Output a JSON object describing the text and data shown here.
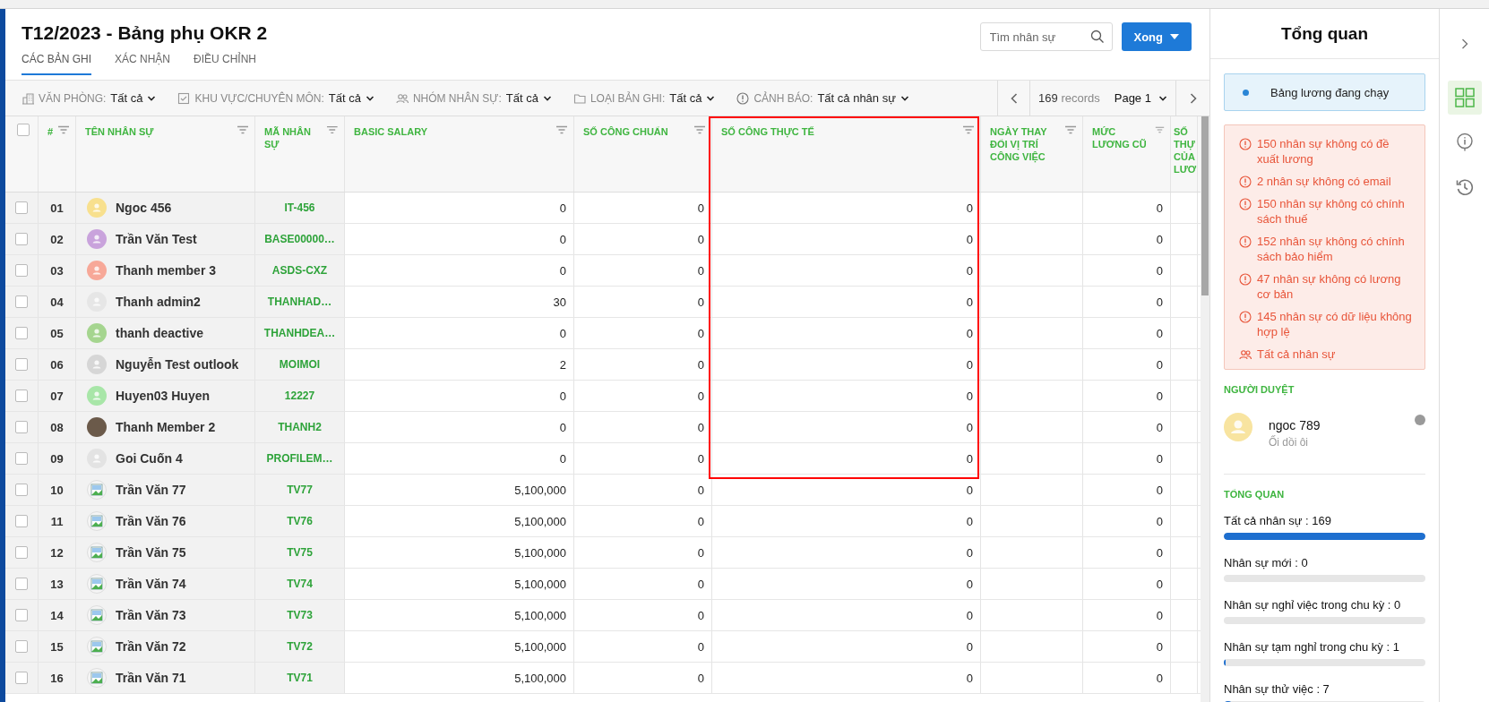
{
  "header": {
    "title": "T12/2023 - Bảng phụ OKR 2",
    "tabs": [
      {
        "label": "CÁC BẢN GHI",
        "selected": true
      },
      {
        "label": "XÁC NHẬN",
        "selected": false
      },
      {
        "label": "ĐIỀU CHỈNH",
        "selected": false
      }
    ],
    "search": {
      "placeholder": "Tìm nhân sự"
    },
    "primary_button": {
      "label": "Xong"
    }
  },
  "filters": [
    {
      "kind": "building",
      "label": "VĂN PHÒNG:",
      "value": "Tất cả"
    },
    {
      "kind": "checkbox",
      "label": "KHU VỰC/CHUYÊN MÔN:",
      "value": "Tất cả"
    },
    {
      "kind": "people",
      "label": "NHÓM NHÂN SỰ:",
      "value": "Tất cả"
    },
    {
      "kind": "folder",
      "label": "LOẠI BẢN GHI:",
      "value": "Tất cả"
    },
    {
      "kind": "warning",
      "label": "CẢNH BÁO:",
      "value": "Tất cả nhân sự"
    }
  ],
  "pagination": {
    "count": "169",
    "unit": "records",
    "page": "Page 1"
  },
  "table": {
    "columns": [
      {
        "kind": "checkbox",
        "checked": false,
        "highlighted": false
      },
      {
        "kind": "index",
        "label": "#",
        "highlighted": false
      },
      {
        "kind": "person",
        "label": "TÊN NHÂN SỰ",
        "highlighted": false
      },
      {
        "kind": "code",
        "label": "MÃ NHÂN SỰ",
        "highlighted": false
      },
      {
        "kind": "number",
        "label": "BASIC SALARY",
        "highlighted": false
      },
      {
        "kind": "number",
        "label": "SỐ CÔNG CHUẨN",
        "highlighted": false
      },
      {
        "kind": "number",
        "label": "SỐ CÔNG THỰC TẾ",
        "highlighted": true
      },
      {
        "kind": "number",
        "label": "NGÀY THAY ĐỔI VỊ TRÍ CÔNG VIỆC",
        "highlighted": false
      },
      {
        "kind": "number",
        "label": "MỨC LƯƠNG CŨ",
        "highlighted": false
      },
      {
        "kind": "number",
        "label": "SỐ THỰ CỦA LƯƠ",
        "highlighted": false
      }
    ],
    "rows": [
      {
        "checked": false,
        "no": "01",
        "name": "Ngoc 456",
        "avatar": {
          "kind": "person",
          "color": "#f8e08e"
        },
        "code": "IT-456",
        "basic_salary": "0",
        "standard_days": "0",
        "actual_days": "0",
        "old_salary": "0"
      },
      {
        "checked": false,
        "no": "02",
        "name": "Trần Văn Test",
        "avatar": {
          "kind": "person",
          "color": "#c9a3dc"
        },
        "code": "BASE00000…",
        "basic_salary": "0",
        "standard_days": "0",
        "actual_days": "0",
        "old_salary": "0"
      },
      {
        "checked": false,
        "no": "03",
        "name": "Thanh member 3",
        "avatar": {
          "kind": "person",
          "color": "#f7a898"
        },
        "code": "ASDS-CXZ",
        "basic_salary": "0",
        "standard_days": "0",
        "actual_days": "0",
        "old_salary": "0"
      },
      {
        "checked": false,
        "no": "04",
        "name": "Thanh admin2",
        "avatar": {
          "kind": "person",
          "color": "#e6e6e6"
        },
        "code": "THANHAD…",
        "basic_salary": "30",
        "standard_days": "0",
        "actual_days": "0",
        "old_salary": "0"
      },
      {
        "checked": false,
        "no": "05",
        "name": "thanh deactive",
        "avatar": {
          "kind": "person",
          "color": "#a5d58f"
        },
        "code": "THANHDEA…",
        "basic_salary": "0",
        "standard_days": "0",
        "actual_days": "0",
        "old_salary": "0"
      },
      {
        "checked": false,
        "no": "06",
        "name": "Nguyễn Test outlook",
        "avatar": {
          "kind": "person",
          "color": "#d6d6d6"
        },
        "code": "MOIMOI",
        "basic_salary": "2",
        "standard_days": "0",
        "actual_days": "0",
        "old_salary": "0"
      },
      {
        "checked": false,
        "no": "07",
        "name": "Huyen03 Huyen",
        "avatar": {
          "kind": "person",
          "color": "#a8e6a8"
        },
        "code": "12227",
        "basic_salary": "0",
        "standard_days": "0",
        "actual_days": "0",
        "old_salary": "0"
      },
      {
        "checked": false,
        "no": "08",
        "name": "Thanh Member 2",
        "avatar": {
          "kind": "photo"
        },
        "code": "THANH2",
        "basic_salary": "0",
        "standard_days": "0",
        "actual_days": "0",
        "old_salary": "0"
      },
      {
        "checked": false,
        "no": "09",
        "name": "Goi Cuốn 4",
        "avatar": {
          "kind": "person",
          "color": "#e3e3e3"
        },
        "code": "PROFILEM…",
        "basic_salary": "0",
        "standard_days": "0",
        "actual_days": "0",
        "old_salary": "0"
      },
      {
        "checked": false,
        "no": "10",
        "name": "Trần Văn 77",
        "avatar": {
          "kind": "image"
        },
        "code": "TV77",
        "basic_salary": "5,100,000",
        "standard_days": "0",
        "actual_days": "0",
        "old_salary": "0"
      },
      {
        "checked": false,
        "no": "11",
        "name": "Trần Văn 76",
        "avatar": {
          "kind": "image"
        },
        "code": "TV76",
        "basic_salary": "5,100,000",
        "standard_days": "0",
        "actual_days": "0",
        "old_salary": "0"
      },
      {
        "checked": false,
        "no": "12",
        "name": "Trần Văn 75",
        "avatar": {
          "kind": "image"
        },
        "code": "TV75",
        "basic_salary": "5,100,000",
        "standard_days": "0",
        "actual_days": "0",
        "old_salary": "0"
      },
      {
        "checked": false,
        "no": "13",
        "name": "Trần Văn 74",
        "avatar": {
          "kind": "image"
        },
        "code": "TV74",
        "basic_salary": "5,100,000",
        "standard_days": "0",
        "actual_days": "0",
        "old_salary": "0"
      },
      {
        "checked": false,
        "no": "14",
        "name": "Trần Văn 73",
        "avatar": {
          "kind": "image"
        },
        "code": "TV73",
        "basic_salary": "5,100,000",
        "standard_days": "0",
        "actual_days": "0",
        "old_salary": "0"
      },
      {
        "checked": false,
        "no": "15",
        "name": "Trần Văn 72",
        "avatar": {
          "kind": "image"
        },
        "code": "TV72",
        "basic_salary": "5,100,000",
        "standard_days": "0",
        "actual_days": "0",
        "old_salary": "0"
      },
      {
        "checked": false,
        "no": "16",
        "name": "Trần Văn 71",
        "avatar": {
          "kind": "image"
        },
        "code": "TV71",
        "basic_salary": "5,100,000",
        "standard_days": "0",
        "actual_days": "0",
        "old_salary": "0"
      }
    ]
  },
  "side_panel": {
    "title": "Tổng quan",
    "status": "Bảng lương đang chạy",
    "warnings": [
      {
        "kind": "alert",
        "text": "150 nhân sự không có đề xuất lương"
      },
      {
        "kind": "alert",
        "text": "2 nhân sự không có email"
      },
      {
        "kind": "alert",
        "text": "150 nhân sự không có chính sách thuế"
      },
      {
        "kind": "alert",
        "text": "152 nhân sự không có chính sách bảo hiểm"
      },
      {
        "kind": "alert",
        "text": "47 nhân sự không có lương cơ bản"
      },
      {
        "kind": "alert",
        "text": "145 nhân sự có dữ liệu không hợp lệ"
      },
      {
        "kind": "people",
        "text": "Tất cả nhân sự"
      }
    ],
    "approver_heading": "NGƯỜI DUYỆT",
    "approver": {
      "name": "ngoc 789",
      "note": "Ối dồi ôi"
    },
    "summary_heading": "TỔNG QUAN",
    "stats": [
      {
        "label": "Tất cả nhân sự : 169",
        "level": 1
      },
      {
        "label": "Nhân sự mới : 0",
        "level": 0
      },
      {
        "label": "Nhân sự nghỉ việc trong chu kỳ : 0",
        "level": 0
      },
      {
        "label": "Nhân sự tạm nghỉ trong chu kỳ : 1",
        "level": 0.006
      },
      {
        "label": "Nhân sự thử việc : 7",
        "level": 0.041
      }
    ]
  },
  "rail": [
    {
      "kind": "grid",
      "selected": true
    },
    {
      "kind": "info",
      "selected": false
    },
    {
      "kind": "history",
      "selected": false
    }
  ]
}
